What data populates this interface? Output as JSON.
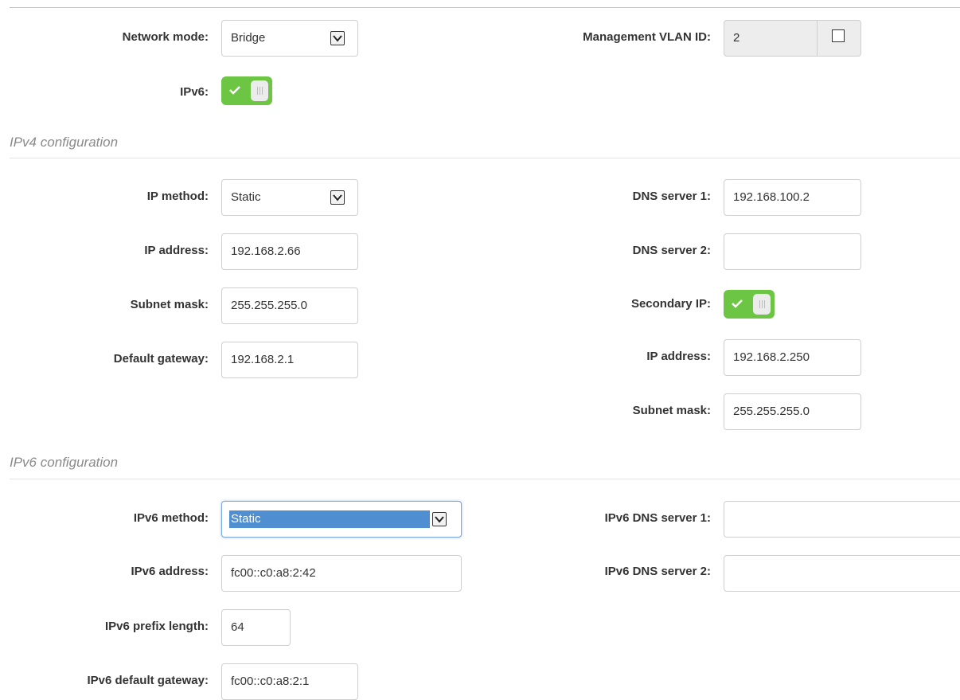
{
  "general": {
    "network_mode_label": "Network mode:",
    "network_mode_value": "Bridge",
    "mgmt_vlan_label": "Management VLAN ID:",
    "mgmt_vlan_value": "2",
    "mgmt_vlan_checked": false,
    "ipv6_label": "IPv6:",
    "ipv6_enabled": true
  },
  "ipv4": {
    "section_title": "IPv4 configuration",
    "ip_method_label": "IP method:",
    "ip_method_value": "Static",
    "ip_address_label": "IP address:",
    "ip_address_value": "192.168.2.66",
    "subnet_mask_label": "Subnet mask:",
    "subnet_mask_value": "255.255.255.0",
    "default_gateway_label": "Default gateway:",
    "default_gateway_value": "192.168.2.1",
    "dns1_label": "DNS server 1:",
    "dns1_value": "192.168.100.2",
    "dns2_label": "DNS server 2:",
    "dns2_value": "",
    "secondary_ip_label": "Secondary IP:",
    "secondary_ip_enabled": true,
    "secondary_ip_address_label": "IP address:",
    "secondary_ip_address_value": "192.168.2.250",
    "secondary_subnet_mask_label": "Subnet mask:",
    "secondary_subnet_mask_value": "255.255.255.0"
  },
  "ipv6": {
    "section_title": "IPv6 configuration",
    "method_label": "IPv6 method:",
    "method_value": "Static",
    "address_label": "IPv6 address:",
    "address_value": "fc00::c0:a8:2:42",
    "prefix_length_label": "IPv6 prefix length:",
    "prefix_length_value": "64",
    "default_gateway_label": "IPv6 default gateway:",
    "default_gateway_value": "fc00::c0:a8:2:1",
    "dns1_label": "IPv6 DNS server 1:",
    "dns1_value": "",
    "dns2_label": "IPv6 DNS server 2:",
    "dns2_value": ""
  },
  "colors": {
    "toggle_on": "#6cc644",
    "selection_highlight": "#4f8ed1",
    "section_title": "#8a8a8a"
  }
}
